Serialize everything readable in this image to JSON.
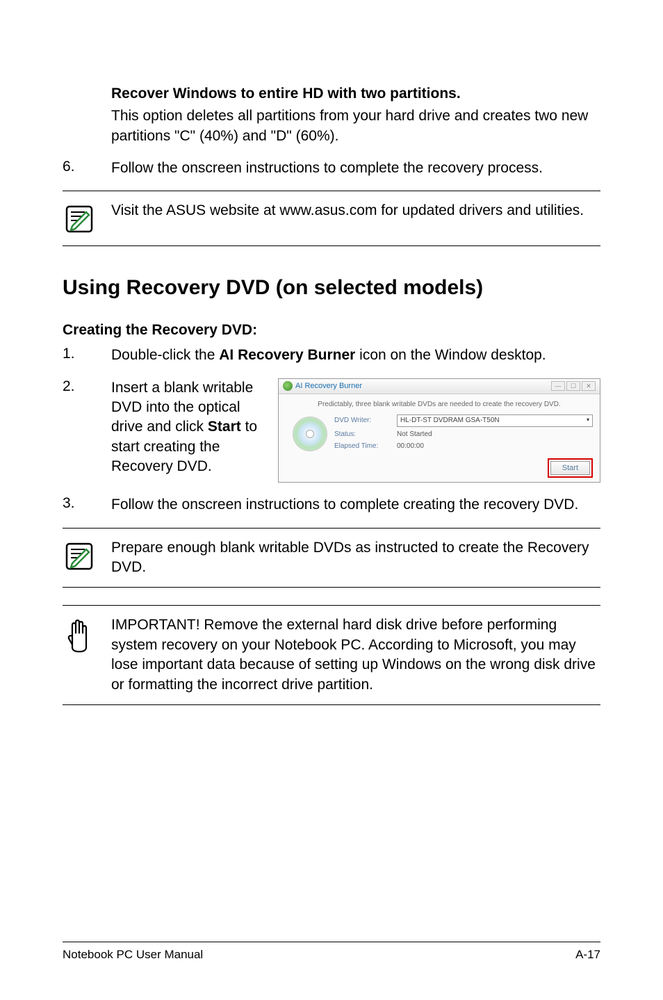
{
  "option_heading": "Recover Windows to entire HD with two partitions.",
  "option_body": "This option deletes all partitions from your hard drive and creates two new partitions \"C\" (40%) and \"D\" (60%).",
  "step6_num": "6.",
  "step6_text": "Follow the onscreen instructions to complete the recovery process.",
  "note1": "Visit the ASUS website at www.asus.com for updated drivers and utilities.",
  "section_title": "Using Recovery DVD (on selected models)",
  "subsection": "Creating the Recovery DVD:",
  "step1_num": "1.",
  "step1_pre": "Double-click the ",
  "step1_bold": "AI Recovery Burner",
  "step1_post": " icon on the Window desktop.",
  "step2_num": "2.",
  "step2_pre": "Insert a blank writable DVD into the optical drive and click ",
  "step2_bold": "Start",
  "step2_post": " to start creating the Recovery DVD.",
  "screenshot": {
    "title": "AI Recovery Burner",
    "prediction": "Predictably, three blank writable DVDs are needed to create the recovery DVD.",
    "label_writer": "DVD Writer:",
    "value_writer": "HL-DT-ST DVDRAM GSA-T50N",
    "label_status": "Status:",
    "value_status": "Not Started",
    "label_elapsed": "Elapsed Time:",
    "value_elapsed": "00:00:00",
    "start_btn": "Start"
  },
  "step3_num": "3.",
  "step3_text": "Follow the onscreen instructions to complete creating the recovery DVD.",
  "note2": "Prepare enough blank writable DVDs as instructed to create the Recovery DVD.",
  "caution": "IMPORTANT! Remove the external hard disk drive before performing system recovery on your Notebook PC. According to Microsoft, you may lose important data because of setting up Windows on the wrong disk drive or formatting the incorrect drive partition.",
  "footer_left": "Notebook PC User Manual",
  "footer_right": "A-17"
}
